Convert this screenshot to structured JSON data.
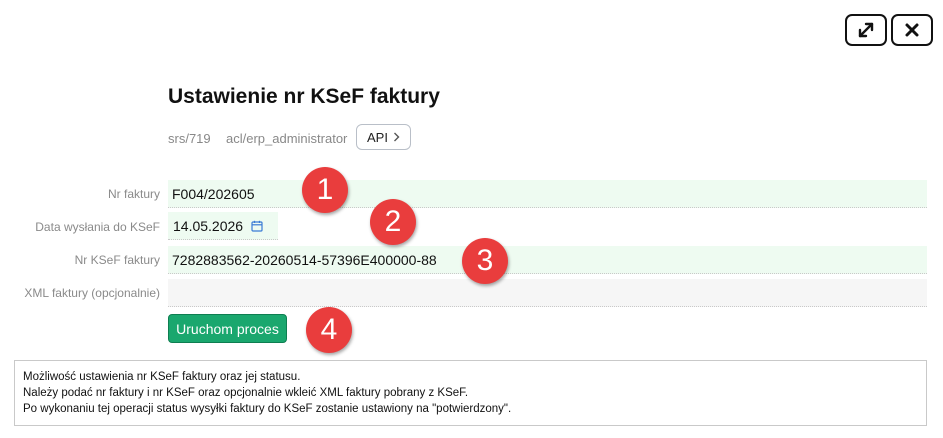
{
  "window_controls": {
    "expand_icon": "expand-arrows-icon",
    "close_icon": "close-x-icon"
  },
  "header": {
    "title": "Ustawienie nr KSeF faktury",
    "meta_code": "srs/719",
    "meta_acl": "acl/erp_administrator",
    "api_label": "API",
    "api_icon": "chevron-right-icon"
  },
  "form": {
    "nr_faktury": {
      "label": "Nr faktury",
      "value": "F004/202605"
    },
    "data_wyslania": {
      "label": "Data wysłania do KSeF",
      "value": "14.05.2026",
      "icon": "calendar-icon"
    },
    "nr_ksef": {
      "label": "Nr KSeF faktury",
      "value": "7282883562-20260514-57396E400000-88"
    },
    "xml": {
      "label": "XML faktury (opcjonalnie)",
      "value": ""
    },
    "submit_label": "Uruchom proces"
  },
  "badges": [
    "1",
    "2",
    "3",
    "4"
  ],
  "info": {
    "line1": "Możliwość ustawienia nr KSeF faktury oraz jej statusu.",
    "line2": "Należy podać nr faktury i nr KSeF oraz opcjonalnie wkleić XML faktury pobrany z KSeF.",
    "line3": "Po wykonaniu tej operacji status wysyłki faktury do KSeF zostanie ustawiony na \"potwierdzony\"."
  },
  "colors": {
    "accent_green": "#1aa76e",
    "field_bg": "#eefbf1",
    "badge_red": "#e93d3d"
  }
}
